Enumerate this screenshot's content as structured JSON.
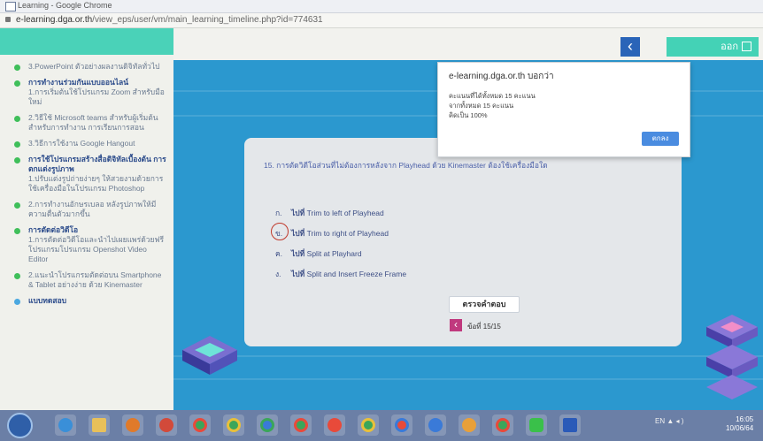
{
  "browser": {
    "title": "Learning - Google Chrome",
    "url_domain": "e-learning.dga.or.th",
    "url_path": "/view_eps/user/vm/main_learning_timeline.php?id=774631"
  },
  "sidebar": {
    "items": [
      {
        "title": "3.PowerPoint ตัวอย่างผลงานดิจิทัลทั่วไป",
        "sub": ""
      },
      {
        "title": "การทำงานร่วมกันแบบออนไลน์",
        "sub": "1.การเริ่มต้นใช้โปรแกรม Zoom สำหรับมือใหม่"
      },
      {
        "title": "2.วิธีใช้ Microsoft teams สำหรับผู้เริ่มต้นสำหรับการทำงาน การเรียนการสอน",
        "sub": ""
      },
      {
        "title": "3.วิธีการใช้งาน Google Hangout",
        "sub": ""
      },
      {
        "title": "การใช้โปรแกรมสร้างสื่อดิจิทัลเบื้องต้น การตกแต่งรูปภาพ",
        "sub": "1.ปรับแต่งรูปถ่ายง่ายๆ ให้สวยงามด้วยการใช้เครื่องมือในโปรแกรม Photoshop"
      },
      {
        "title": "2.การทำงานอักษรเบลอ หลังรูปภาพให้มีความตื่นตัวมากขึ้น",
        "sub": ""
      },
      {
        "title": "การตัดต่อวิดีโอ",
        "sub": "1.การตัดต่อวิดีโอและนำไปเผยแพร่ด้วยฟรีโปรแกรมโปรแกรม Openshot Video Editor"
      },
      {
        "title": "2.แนะนำโปรแกรมตัดต่อบน Smartphone & Tablet อย่างง่าย ด้วย Kinemaster",
        "sub": ""
      },
      {
        "title": "แบบทดสอบ",
        "sub": ""
      }
    ]
  },
  "header": {
    "back_icon": "‹",
    "exit_label": "ออก"
  },
  "popup": {
    "title": "e-learning.dga.or.th บอกว่า",
    "line1": "คะแนนที่ได้ทั้งหมด 15 คะแนน",
    "line2": "จากทั้งหมด 15 คะแนน",
    "line3": "คิดเป็น 100%",
    "ok_label": "ตกลง"
  },
  "quiz": {
    "question": "15. การตัดวิดีโอส่วนที่ไม่ต้องการหลังจาก Playhead ด้วย Kinemaster ต้องใช้เครื่องมือใด",
    "options": [
      {
        "letter": "ก.",
        "prefix": "ไปที่",
        "text": "Trim to left of Playhead"
      },
      {
        "letter": "ข.",
        "prefix": "ไปที่",
        "text": "Trim to right of Playhead"
      },
      {
        "letter": "ค.",
        "prefix": "ไปที่",
        "text": "Split at Playhard"
      },
      {
        "letter": "ง.",
        "prefix": "ไปที่",
        "text": "Split and Insert Freeze Frame"
      }
    ],
    "check_label": "ตรวจคำตอบ",
    "page_label": "ข้อที่ 15/15",
    "prev_icon": "‹"
  },
  "taskbar": {
    "tray_text": "EN ▲ ◂ )",
    "time": "16:05",
    "date": "10/06/64"
  },
  "colors": {
    "accent_teal": "#4ad2b8",
    "main_blue": "#2b98cf",
    "nav_blue": "#2a64b8",
    "orange": "#f3b018"
  }
}
